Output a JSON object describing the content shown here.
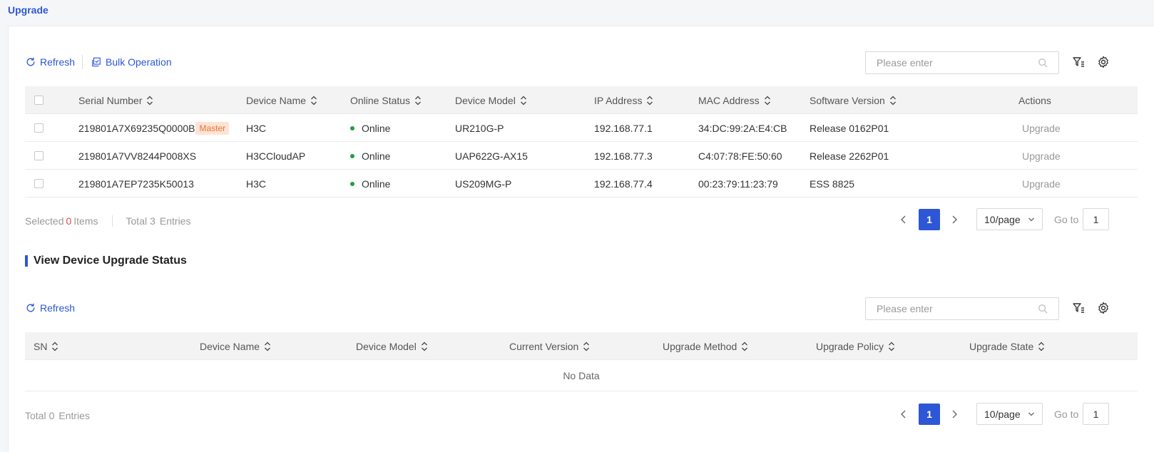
{
  "page": {
    "tab_title": "Upgrade"
  },
  "toolbar1": {
    "refresh_label": "Refresh",
    "bulk_label": "Bulk Operation",
    "search_placeholder": "Please enter"
  },
  "table1": {
    "headers": {
      "serial": "Serial Number",
      "device_name": "Device Name",
      "online_status": "Online Status",
      "device_model": "Device Model",
      "ip": "IP Address",
      "mac": "MAC Address",
      "software": "Software Version",
      "actions": "Actions"
    },
    "rows": [
      {
        "serial": "219801A7X69235Q0000B",
        "badge": "Master",
        "device_name": "H3C",
        "status": "Online",
        "model": "UR210G-P",
        "ip": "192.168.77.1",
        "mac": "34:DC:99:2A:E4:CB",
        "software": "Release 0162P01",
        "action": "Upgrade"
      },
      {
        "serial": "219801A7VV8244P008XS",
        "badge": "",
        "device_name": "H3CCloudAP",
        "status": "Online",
        "model": "UAP622G-AX15",
        "ip": "192.168.77.3",
        "mac": "C4:07:78:FE:50:60",
        "software": "Release 2262P01",
        "action": "Upgrade"
      },
      {
        "serial": "219801A7EP7235K50013",
        "badge": "",
        "device_name": "H3C",
        "status": "Online",
        "model": "US209MG-P",
        "ip": "192.168.77.4",
        "mac": "00:23:79:11:23:79",
        "software": "ESS 8825",
        "action": "Upgrade"
      }
    ]
  },
  "footer1": {
    "selected_prefix": "Selected",
    "selected_count": "0",
    "selected_suffix": "Items",
    "total_prefix": "Total",
    "total_count": "3",
    "total_suffix": "Entries",
    "current_page": "1",
    "page_size": "10/page",
    "goto_label": "Go to",
    "goto_value": "1"
  },
  "section2": {
    "title": "View Device Upgrade Status"
  },
  "toolbar2": {
    "refresh_label": "Refresh",
    "search_placeholder": "Please enter"
  },
  "table2": {
    "headers": {
      "sn": "SN",
      "device_name": "Device Name",
      "device_model": "Device Model",
      "current_version": "Current Version",
      "upgrade_method": "Upgrade Method",
      "upgrade_policy": "Upgrade Policy",
      "upgrade_state": "Upgrade State"
    },
    "empty_text": "No Data"
  },
  "footer2": {
    "total_prefix": "Total",
    "total_count": "0",
    "total_suffix": "Entries",
    "current_page": "1",
    "page_size": "10/page",
    "goto_label": "Go to",
    "goto_value": "1"
  },
  "colors": {
    "accent": "#2d57d5",
    "online": "#1f9e41",
    "badge_bg": "#fde4d4",
    "badge_text": "#e8743b",
    "selected_count": "#e54545"
  }
}
